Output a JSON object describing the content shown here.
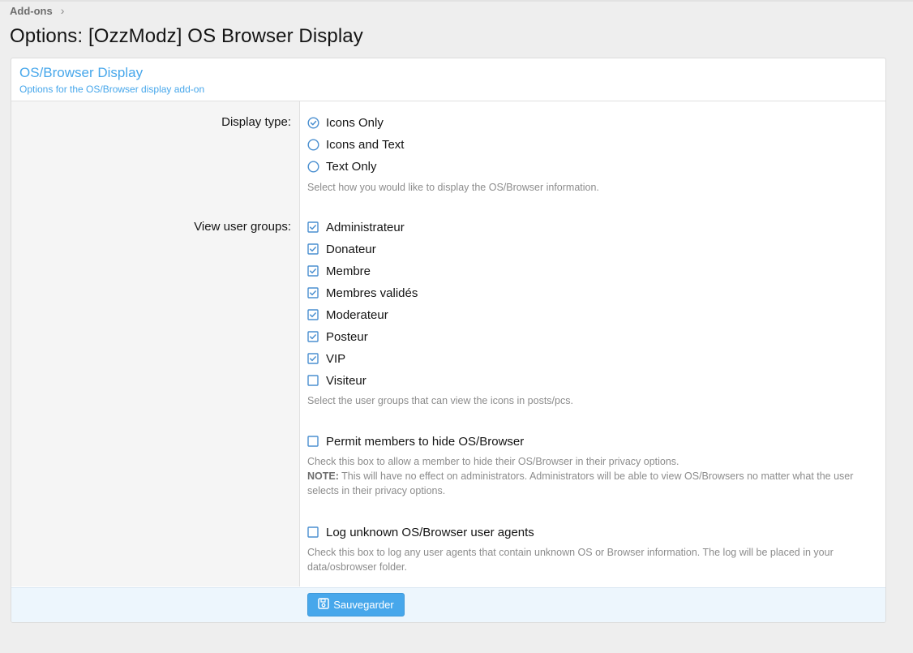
{
  "breadcrumb": {
    "items": [
      "Add-ons"
    ]
  },
  "page": {
    "title": "Options: [OzzModz] OS Browser Display"
  },
  "block": {
    "title": "OS/Browser Display",
    "description": "Options for the OS/Browser display add-on"
  },
  "display_type": {
    "label": "Display type:",
    "options": [
      {
        "label": "Icons Only",
        "selected": true
      },
      {
        "label": "Icons and Text",
        "selected": false
      },
      {
        "label": "Text Only",
        "selected": false
      }
    ],
    "hint": "Select how you would like to display the OS/Browser information."
  },
  "user_groups": {
    "label": "View user groups:",
    "options": [
      {
        "label": "Administrateur",
        "checked": true
      },
      {
        "label": "Donateur",
        "checked": true
      },
      {
        "label": "Membre",
        "checked": true
      },
      {
        "label": "Membres validés",
        "checked": true
      },
      {
        "label": "Moderateur",
        "checked": true
      },
      {
        "label": "Posteur",
        "checked": true
      },
      {
        "label": "VIP",
        "checked": true
      },
      {
        "label": "Visiteur",
        "checked": false
      }
    ],
    "hint": "Select the user groups that can view the icons in posts/pcs."
  },
  "permit_hide": {
    "label": "Permit members to hide OS/Browser",
    "checked": false,
    "hint": "Check this box to allow a member to hide their OS/Browser in their privacy options.",
    "note_label": "NOTE:",
    "note_text": " This will have no effect on administrators. Administrators will be able to view OS/Browsers no matter what the user selects in their privacy options."
  },
  "log_unknown": {
    "label": "Log unknown OS/Browser user agents",
    "checked": false,
    "hint": "Check this box to log any user agents that contain unknown OS or Browser information. The log will be placed in your data/osbrowser folder."
  },
  "footer": {
    "save_label": "Sauvegarder"
  },
  "colors": {
    "accent": "#47a7eb",
    "check": "#4a8fd0"
  },
  "icons": {
    "breadcrumb_separator": "chevron-right-icon",
    "save": "save-icon"
  }
}
